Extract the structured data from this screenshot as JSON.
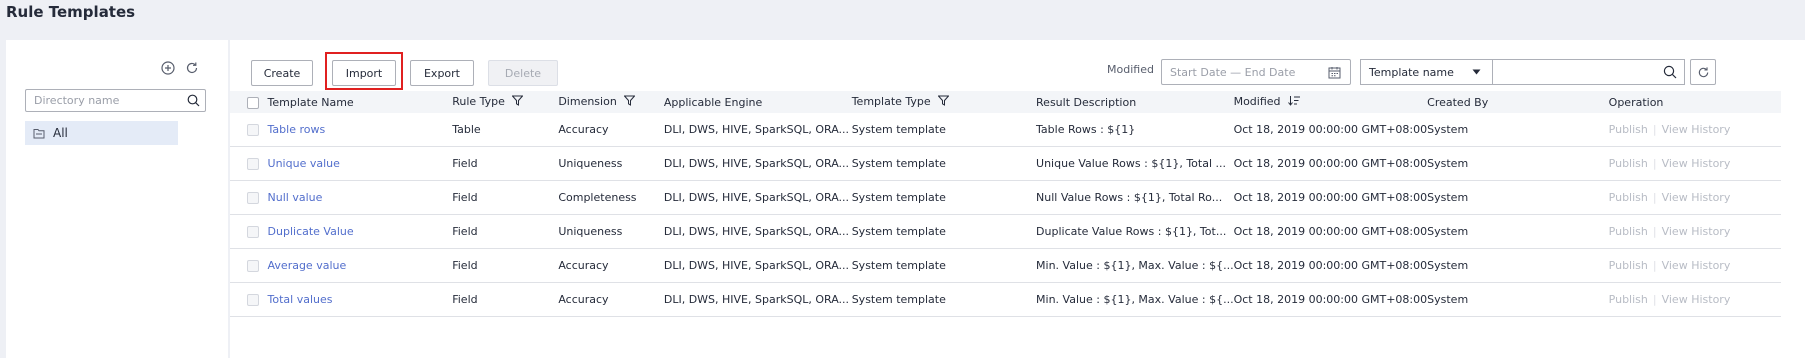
{
  "page": {
    "title": "Rule Templates"
  },
  "sidebar": {
    "search_placeholder": "Directory name",
    "tree": [
      {
        "label": "All"
      }
    ]
  },
  "toolbar": {
    "create_label": "Create",
    "import_label": "Import",
    "export_label": "Export",
    "delete_label": "Delete",
    "modified_label": "Modified",
    "date_placeholder": "Start Date — End Date",
    "search_field_selected": "Template name",
    "search_value": ""
  },
  "table": {
    "columns": [
      "Template Name",
      "Rule Type",
      "Dimension",
      "Applicable Engine",
      "Template Type",
      "Result Description",
      "Modified",
      "Created By",
      "Operation"
    ],
    "rows": [
      {
        "name": "Table rows",
        "rule_type": "Table",
        "dimension": "Accuracy",
        "engine": "DLI, DWS, HIVE, SparkSQL, ORA...",
        "template_type": "System template",
        "result": "Table Rows : ${1}",
        "modified": "Oct 18, 2019 00:00:00 GMT+08:00",
        "created_by": "System"
      },
      {
        "name": "Unique value",
        "rule_type": "Field",
        "dimension": "Uniqueness",
        "engine": "DLI, DWS, HIVE, SparkSQL, ORA...",
        "template_type": "System template",
        "result": "Unique Value Rows : ${1}, Total ...",
        "modified": "Oct 18, 2019 00:00:00 GMT+08:00",
        "created_by": "System"
      },
      {
        "name": "Null value",
        "rule_type": "Field",
        "dimension": "Completeness",
        "engine": "DLI, DWS, HIVE, SparkSQL, ORA...",
        "template_type": "System template",
        "result": "Null Value Rows : ${1}, Total Ro...",
        "modified": "Oct 18, 2019 00:00:00 GMT+08:00",
        "created_by": "System"
      },
      {
        "name": "Duplicate Value",
        "rule_type": "Field",
        "dimension": "Uniqueness",
        "engine": "DLI, DWS, HIVE, SparkSQL, ORA...",
        "template_type": "System template",
        "result": "Duplicate Value Rows : ${1}, Tot...",
        "modified": "Oct 18, 2019 00:00:00 GMT+08:00",
        "created_by": "System"
      },
      {
        "name": "Average value",
        "rule_type": "Field",
        "dimension": "Accuracy",
        "engine": "DLI, DWS, HIVE, SparkSQL, ORA...",
        "template_type": "System template",
        "result": "Min. Value : ${1}, Max. Value : ${...",
        "modified": "Oct 18, 2019 00:00:00 GMT+08:00",
        "created_by": "System"
      },
      {
        "name": "Total values",
        "rule_type": "Field",
        "dimension": "Accuracy",
        "engine": "DLI, DWS, HIVE, SparkSQL, ORA...",
        "template_type": "System template",
        "result": "Min. Value : ${1}, Max. Value : ${...",
        "modified": "Oct 18, 2019 00:00:00 GMT+08:00",
        "created_by": "System"
      }
    ],
    "operations": {
      "publish": "Publish",
      "view_history": "View History"
    }
  },
  "colors": {
    "link": "#526ecc",
    "highlight": "#e02020",
    "selected_tree": "#e4ebf7"
  }
}
